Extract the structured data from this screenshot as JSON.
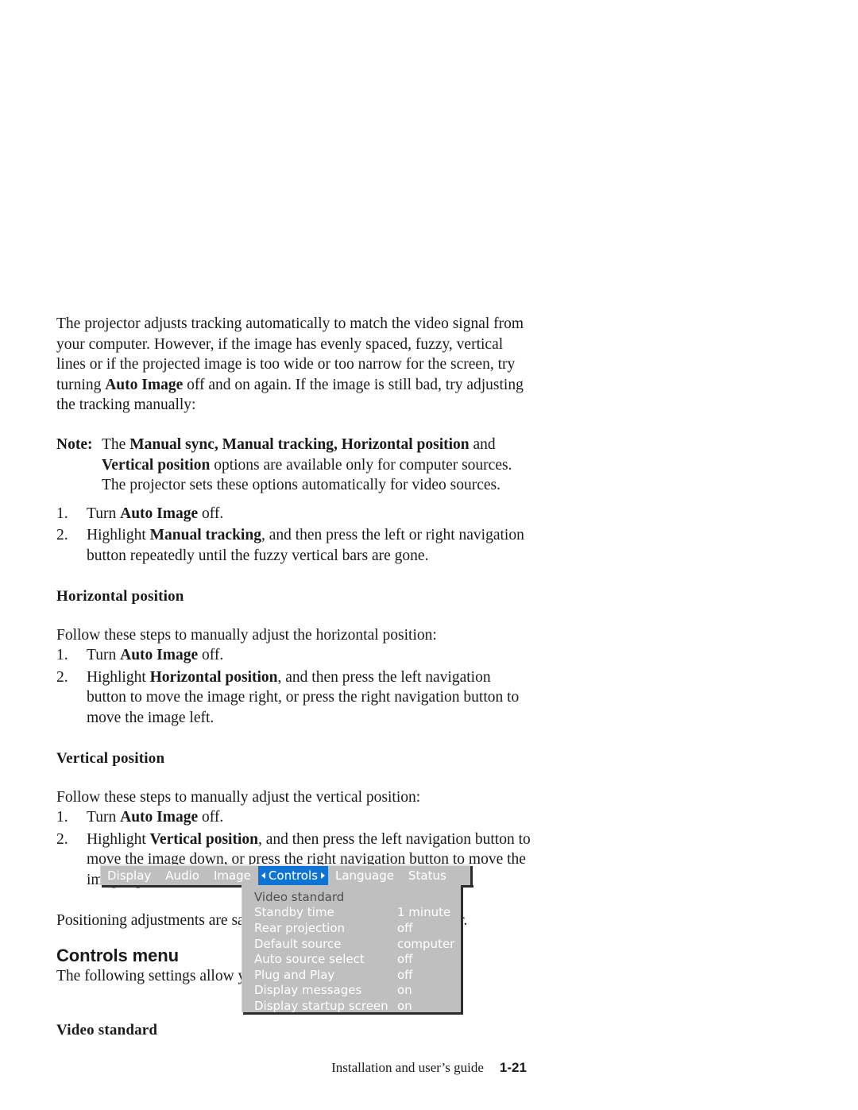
{
  "document": {
    "footer_text": "Installation and user’s guide",
    "page_number": "1-21"
  },
  "colors": {
    "menu_bar_gray": "#bfbfbf",
    "panel_gray": "#bfbfbf",
    "active_tab_blue": "#0d74d4",
    "shadow": "#2c2c2c",
    "label_white": "#ffffff",
    "disabled_label": "#4e4e4e"
  },
  "body": {
    "intro": {
      "part1": "The projector adjusts tracking automatically to match the video signal from your computer. However, if the image has evenly spaced, fuzzy, vertical lines or if the projected image is too wide or too narrow for the screen, try turning ",
      "bold1": "Auto Image",
      "part2": " off and on again. If the image is still bad, try adjusting the tracking manually:"
    },
    "note": {
      "label": "Note:",
      "part1": "The ",
      "bold1": "Manual sync, Manual tracking, Horizontal position",
      "part2": " and ",
      "bold2": "Vertical position",
      "part3": " options are available only for computer sources. The projector sets these options automatically for video sources."
    },
    "tracking_steps": [
      {
        "num": "1.",
        "pre": "Turn ",
        "bold": "Auto Image",
        "post": " off."
      },
      {
        "num": "2.",
        "pre": "Highlight ",
        "bold": "Manual tracking",
        "post": ", and then press the left or right navigation button repeatedly until the fuzzy vertical bars are gone."
      }
    ],
    "horizontal": {
      "heading": "Horizontal position",
      "intro": "Follow these steps to manually adjust the horizontal position:",
      "steps": [
        {
          "num": "1.",
          "pre": "Turn ",
          "bold": "Auto Image",
          "post": " off."
        },
        {
          "num": "2.",
          "pre": "Highlight ",
          "bold": "Horizontal position",
          "post": ", and then press the left navigation button to move the image right, or press the right navigation button to move the image left."
        }
      ]
    },
    "vertical": {
      "heading": "Vertical position",
      "intro": "Follow these steps to manually adjust the vertical position:",
      "steps": [
        {
          "num": "1.",
          "pre": "Turn ",
          "bold": "Auto Image",
          "post": " off."
        },
        {
          "num": "2.",
          "pre": "Highlight ",
          "bold": "Vertical position",
          "post": ", and then press the left navigation button to move the image down, or press the right navigation button to move the image up."
        }
      ]
    },
    "positioning_note": "Positioning adjustments are saved when you turn off the projector.",
    "controls_menu": {
      "heading": "Controls menu",
      "intro": "The following settings allow you to adjust the controls."
    },
    "video_standard_heading": "Video standard"
  },
  "osd": {
    "tabs": [
      {
        "label": "Display",
        "active": false
      },
      {
        "label": "Audio",
        "active": false
      },
      {
        "label": "Image",
        "active": false
      },
      {
        "label": "Controls",
        "active": true
      },
      {
        "label": "Language",
        "active": false
      },
      {
        "label": "Status",
        "active": false
      }
    ],
    "active_tab_marker_left": "left-triangle-icon",
    "active_tab_marker_right": "right-triangle-icon",
    "menu_items": [
      {
        "label": "Video standard",
        "value": "",
        "dim": true
      },
      {
        "label": "Standby time",
        "value": "1 minute",
        "dim": false
      },
      {
        "label": "Rear projection",
        "value": "off",
        "dim": false
      },
      {
        "label": "Default source",
        "value": "computer",
        "dim": false
      },
      {
        "label": "Auto source select",
        "value": "off",
        "dim": false
      },
      {
        "label": "Plug and Play",
        "value": "off",
        "dim": false
      },
      {
        "label": "Display messages",
        "value": "on",
        "dim": false
      },
      {
        "label": "Display startup screen",
        "value": "on",
        "dim": false
      }
    ]
  }
}
